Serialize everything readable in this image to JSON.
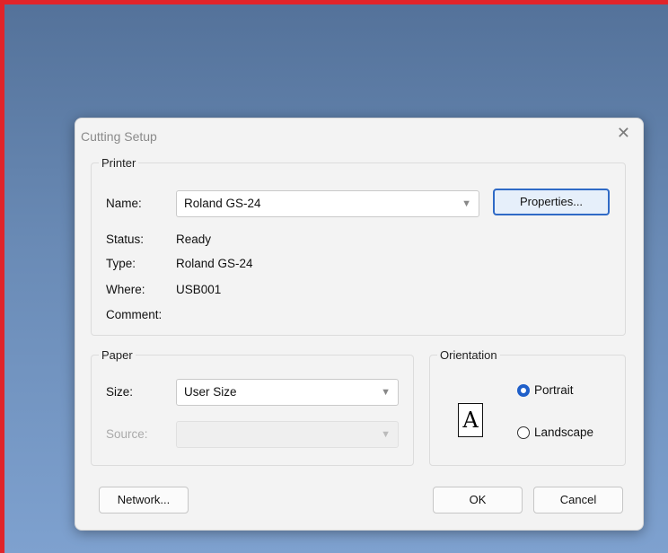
{
  "dialog": {
    "title": "Cutting Setup",
    "close_symbol": "✕"
  },
  "printer": {
    "group_label": "Printer",
    "name_label": "Name:",
    "name_value": "Roland GS-24",
    "properties_label": "Properties...",
    "status_label": "Status:",
    "status_value": "Ready",
    "type_label": "Type:",
    "type_value": "Roland GS-24",
    "where_label": "Where:",
    "where_value": "USB001",
    "comment_label": "Comment:",
    "comment_value": ""
  },
  "paper": {
    "group_label": "Paper",
    "size_label": "Size:",
    "size_value": "User Size",
    "source_label": "Source:",
    "source_value": ""
  },
  "orientation": {
    "group_label": "Orientation",
    "page_icon_glyph": "A",
    "portrait_label": "Portrait",
    "landscape_label": "Landscape",
    "selected": "Portrait"
  },
  "buttons": {
    "network_label": "Network...",
    "ok_label": "OK",
    "cancel_label": "Cancel"
  },
  "colors": {
    "accent": "#1f5fc9",
    "frame": "#e0242a"
  }
}
